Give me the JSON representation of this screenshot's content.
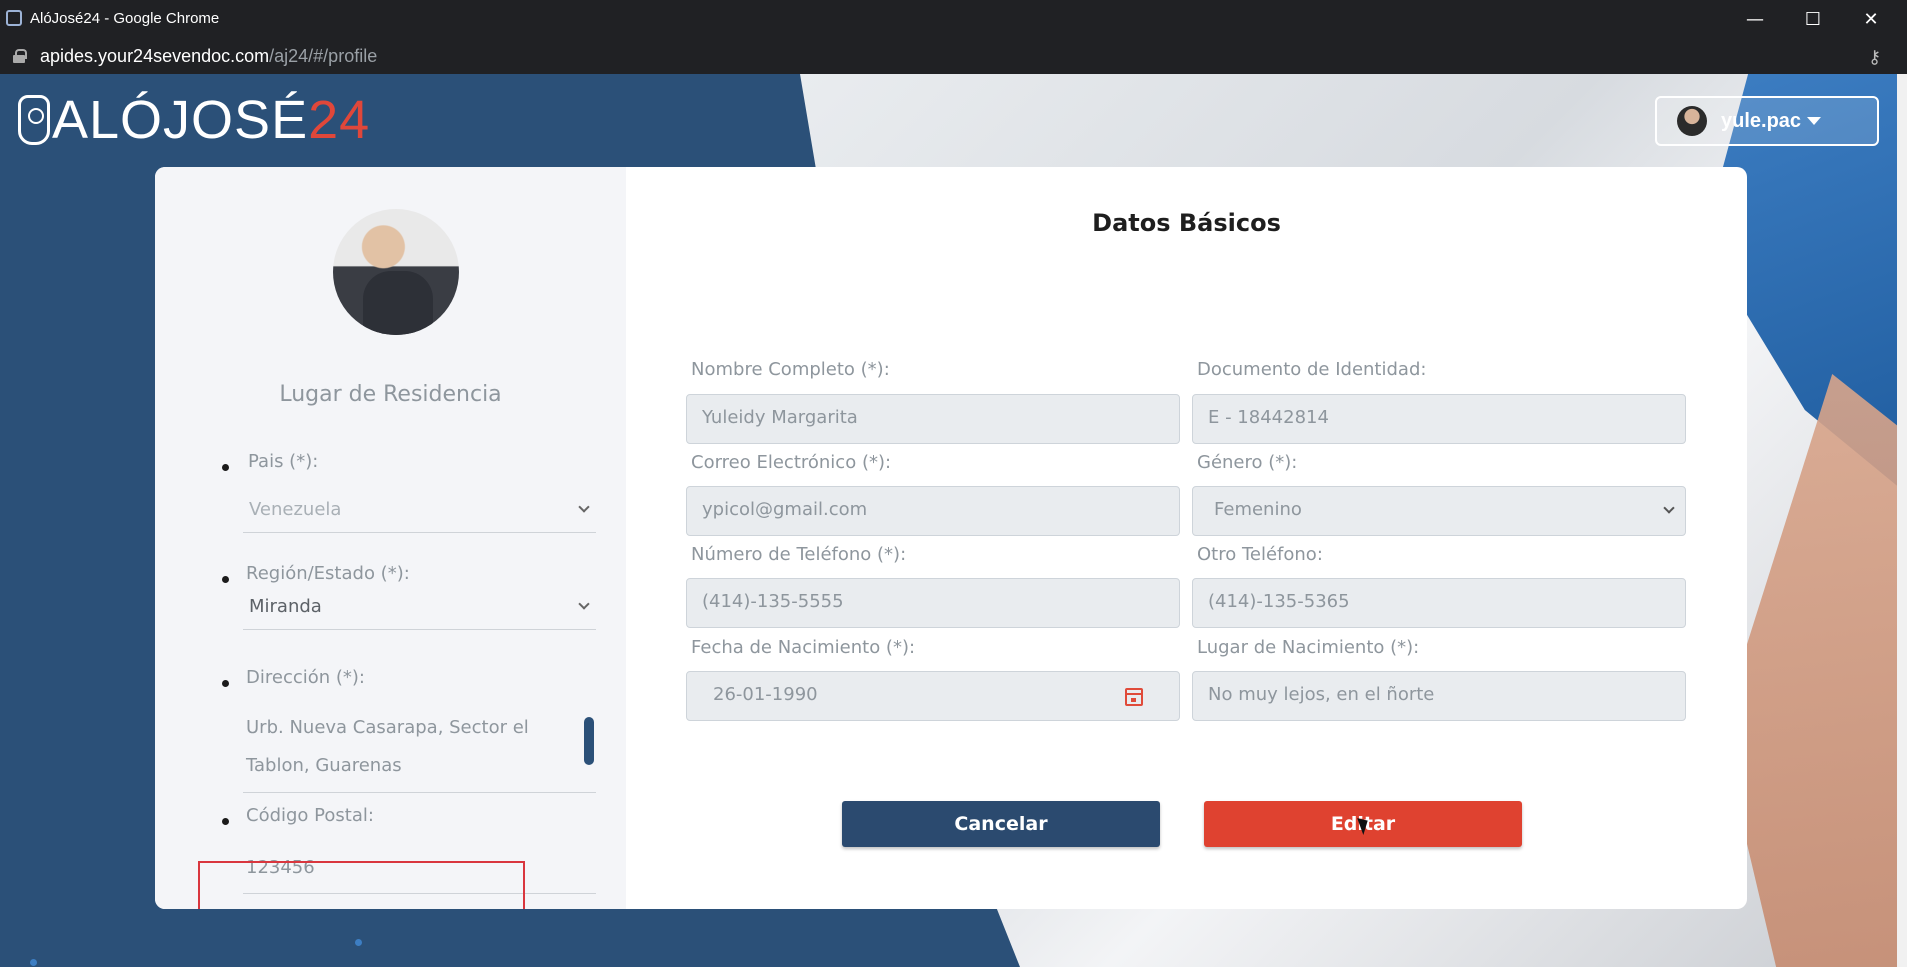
{
  "browser": {
    "window_title": "AlóJosé24 - Google Chrome",
    "url_host": "apides.your24sevendoc.com",
    "url_path": "/aj24/#/profile"
  },
  "logo": {
    "text_main": "ALÓJOSÉ",
    "text_accent": "24"
  },
  "user": {
    "name": "yule.pac"
  },
  "left": {
    "section_title": "Lugar de Residencia",
    "pais_label": "Pais (*):",
    "pais_value": "Venezuela",
    "region_label": "Región/Estado (*):",
    "region_value": "Miranda",
    "direccion_label": "Dirección (*):",
    "direccion_value": "Urb. Nueva Casarapa, Sector el Tablon, Guarenas",
    "postal_label": "Código Postal:",
    "postal_value": "123456"
  },
  "form": {
    "title": "Datos Básicos",
    "nombre_label": "Nombre Completo (*):",
    "nombre_value": "Yuleidy Margarita",
    "documento_label": "Documento de Identidad:",
    "documento_value": "E - 18442814",
    "correo_label": "Correo Electrónico (*):",
    "correo_value": "ypicol@gmail.com",
    "genero_label": "Género (*):",
    "genero_value": "Femenino",
    "telefono_label": "Número de Teléfono (*):",
    "telefono_value": "(414)-135-5555",
    "otro_label": "Otro Teléfono:",
    "otro_value": "(414)-135-5365",
    "fecha_label": "Fecha de Nacimiento (*):",
    "fecha_value": "26-01-1990",
    "lugar_label": "Lugar de Nacimiento (*):",
    "lugar_value": "No muy lejos, en el ñorte"
  },
  "buttons": {
    "cancel": "Cancelar",
    "edit": "Editar"
  },
  "colors": {
    "page_bg": "#2b5078",
    "accent_red": "#df4230",
    "button_blue": "#2b4a6f"
  }
}
